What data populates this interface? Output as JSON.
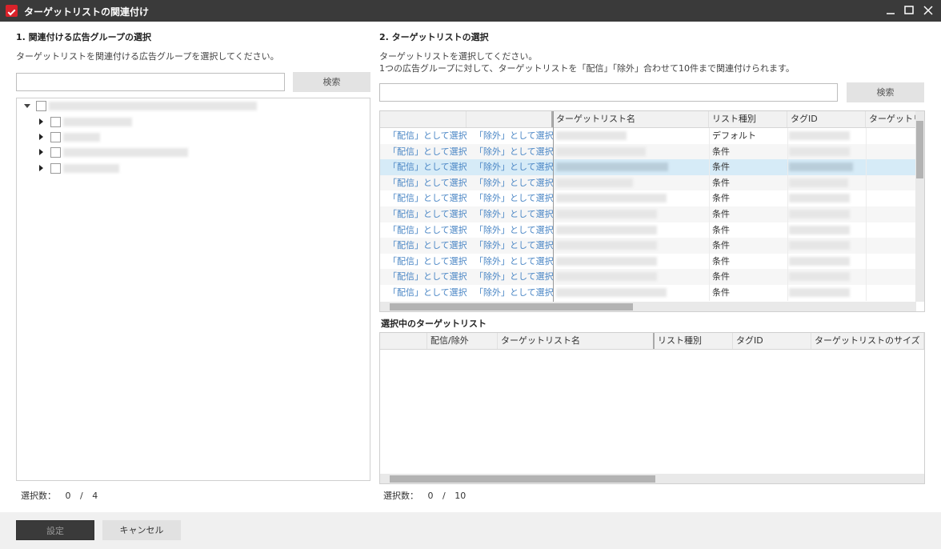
{
  "window": {
    "title": "ターゲットリストの関連付け",
    "minimize_icon": "minimize-icon",
    "maximize_icon": "maximize-icon",
    "close_icon": "close-icon"
  },
  "left": {
    "section_title": "1. 関連付ける広告グループの選択",
    "description": "ターゲットリストを関連付ける広告グループを選択してください。",
    "search_value": "",
    "search_button": "検索",
    "count_label": "選択数：",
    "count_value": "0",
    "count_sep": "/",
    "count_max": "4"
  },
  "right": {
    "section_title": "2. ターゲットリストの選択",
    "description_line1": "ターゲットリストを選択してください。",
    "description_line2": "1つの広告グループに対して、ターゲットリストを「配信」「除外」合わせて10件まで関連付けられます。",
    "search_value": "",
    "search_button": "検索",
    "columns": [
      "",
      "",
      "ターゲットリスト名",
      "リスト種別",
      "タグID",
      "ターゲットリ"
    ],
    "rows": [
      {
        "deliver": "「配信」として選択",
        "exclude": "「除外」として選択",
        "type": "デフォルト"
      },
      {
        "deliver": "「配信」として選択",
        "exclude": "「除外」として選択",
        "type": "条件"
      },
      {
        "deliver": "「配信」として選択",
        "exclude": "「除外」として選択",
        "type": "条件"
      },
      {
        "deliver": "「配信」として選択",
        "exclude": "「除外」として選択",
        "type": "条件"
      },
      {
        "deliver": "「配信」として選択",
        "exclude": "「除外」として選択",
        "type": "条件"
      },
      {
        "deliver": "「配信」として選択",
        "exclude": "「除外」として選択",
        "type": "条件"
      },
      {
        "deliver": "「配信」として選択",
        "exclude": "「除外」として選択",
        "type": "条件"
      },
      {
        "deliver": "「配信」として選択",
        "exclude": "「除外」として選択",
        "type": "条件"
      },
      {
        "deliver": "「配信」として選択",
        "exclude": "「除外」として選択",
        "type": "条件"
      },
      {
        "deliver": "「配信」として選択",
        "exclude": "「除外」として選択",
        "type": "条件"
      },
      {
        "deliver": "「配信」として選択",
        "exclude": "「除外」として選択",
        "type": "条件"
      }
    ],
    "selected_title": "選択中のターゲットリスト",
    "selected_columns": [
      "",
      "配信/除外",
      "ターゲットリスト名",
      "リスト種別",
      "タグID",
      "ターゲットリストのサイズ"
    ],
    "count_label": "選択数：",
    "count_value": "0",
    "count_sep": "/",
    "count_max": "10"
  },
  "footer": {
    "ok_button": "設定",
    "cancel_button": "キャンセル"
  }
}
